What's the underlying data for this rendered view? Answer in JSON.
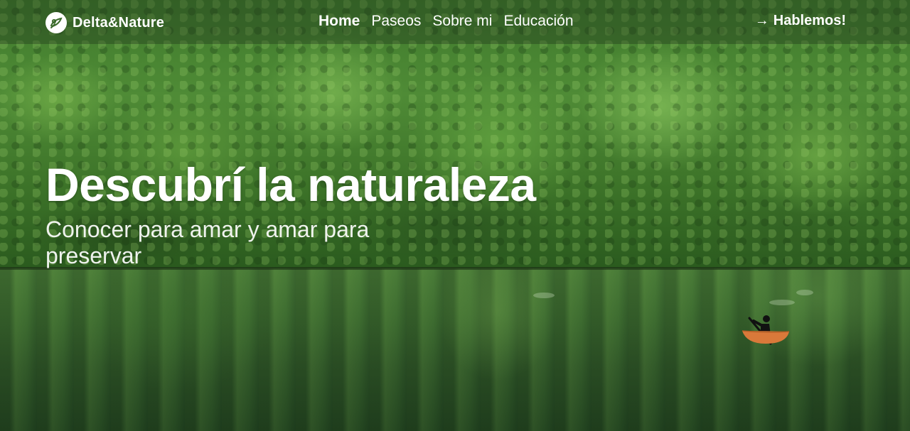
{
  "brand": {
    "name": "Delta&Nature",
    "logo_icon": "leaf-swirl-icon"
  },
  "nav": {
    "links": [
      {
        "label": "Home",
        "active": true
      },
      {
        "label": "Paseos",
        "active": false
      },
      {
        "label": "Sobre mi",
        "active": false
      },
      {
        "label": "Educación",
        "active": false
      }
    ],
    "cta": {
      "arrow": "→",
      "label": "Hablemos!"
    }
  },
  "hero": {
    "title": "Descubrí la naturaleza",
    "subtitle": "Conocer para amar y amar para preservar",
    "illustration": "kayaker-icon"
  },
  "colors": {
    "text": "#ffffff",
    "kayak": "#d9793a",
    "paddler": "#111111"
  }
}
